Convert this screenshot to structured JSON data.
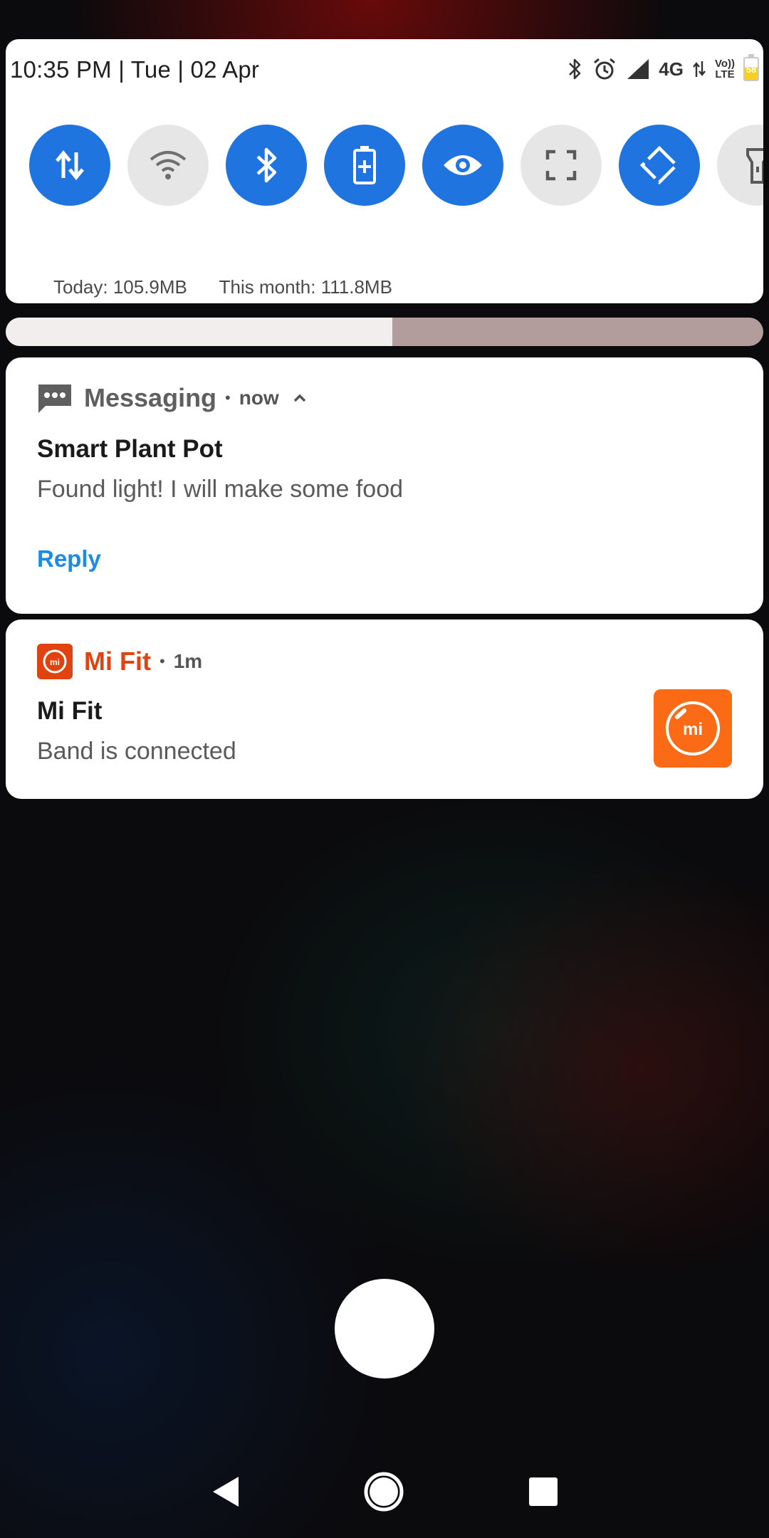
{
  "status_bar": {
    "datetime": "10:35 PM | Tue | 02 Apr",
    "network": "4G",
    "volte_top": "Vo))",
    "volte_bottom": "LTE",
    "battery_level": "58",
    "icons": [
      "bluetooth-icon",
      "alarm-icon",
      "signal-icon",
      "data-arrows-icon"
    ]
  },
  "quick_settings": {
    "tiles": [
      {
        "name": "mobile-data",
        "icon": "data-transfer-icon",
        "active": true
      },
      {
        "name": "wifi",
        "icon": "wifi-icon",
        "active": false
      },
      {
        "name": "bluetooth",
        "icon": "bluetooth-icon",
        "active": true
      },
      {
        "name": "battery-saver",
        "icon": "battery-plus-icon",
        "active": true
      },
      {
        "name": "reading-mode",
        "icon": "eye-icon",
        "active": true
      },
      {
        "name": "screenshot",
        "icon": "crop-icon",
        "active": false
      },
      {
        "name": "auto-rotate",
        "icon": "rotate-icon",
        "active": true
      },
      {
        "name": "flashlight",
        "icon": "flashlight-icon",
        "active": false
      }
    ],
    "usage_today": "Today: 105.9MB",
    "usage_month": "This month: 111.8MB",
    "brightness_fraction": 0.51
  },
  "notifications": [
    {
      "app": "Messaging",
      "time": "now",
      "title": "Smart Plant Pot",
      "text": "Found light! I will make some food",
      "action": "Reply",
      "app_color": "#5f5f5f"
    },
    {
      "app": "Mi Fit",
      "time": "1m",
      "title": "Mi Fit",
      "text": "Band is connected",
      "app_color": "#e0430f",
      "thumb_color": "#fb6a14"
    }
  ],
  "separator": "•"
}
